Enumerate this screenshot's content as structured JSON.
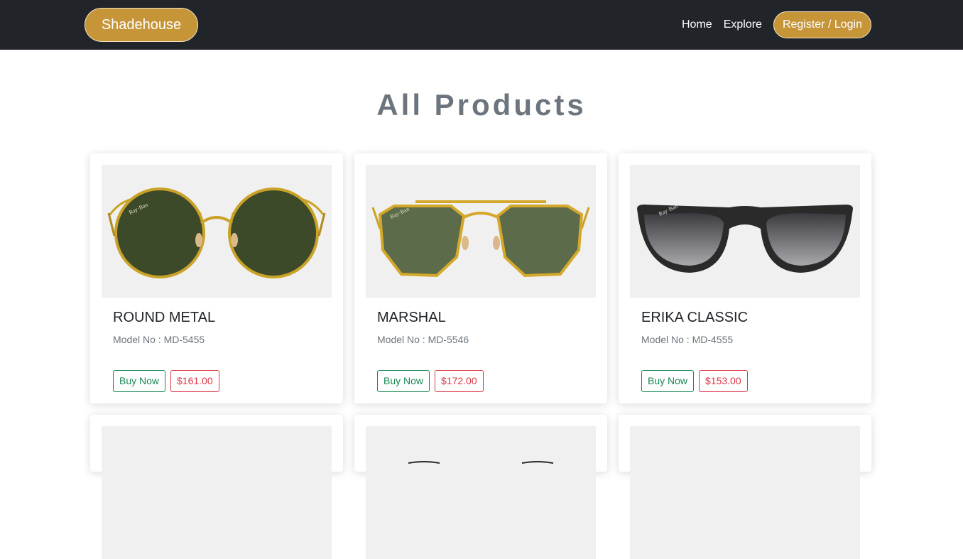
{
  "navbar": {
    "brand": "Shadehouse",
    "links": [
      "Home",
      "Explore"
    ],
    "cta": "Register / Login"
  },
  "page": {
    "title": "All Products"
  },
  "products": [
    {
      "name": "ROUND METAL",
      "model": "Model No : MD-5455",
      "buy_label": "Buy Now",
      "price": "$161.00",
      "image": "round-metal-sunglasses",
      "frame_color": "#c9a227",
      "lens_color": "#3d4a2a"
    },
    {
      "name": "MARSHAL",
      "model": "Model No : MD-5546",
      "buy_label": "Buy Now",
      "price": "$172.00",
      "image": "marshal-sunglasses",
      "frame_color": "#d4a82a",
      "lens_color": "#5c6b4a"
    },
    {
      "name": "ERIKA CLASSIC",
      "model": "Model No : MD-4555",
      "buy_label": "Buy Now",
      "price": "$153.00",
      "image": "erika-classic-sunglasses",
      "frame_color": "#2a2a2a",
      "lens_color": "#5a5a5f"
    }
  ],
  "colors": {
    "navbar_bg": "#212529",
    "accent_gold": "#c59538",
    "buy_green": "#198754",
    "price_red": "#dc3545",
    "title_gray": "#6c757d"
  }
}
